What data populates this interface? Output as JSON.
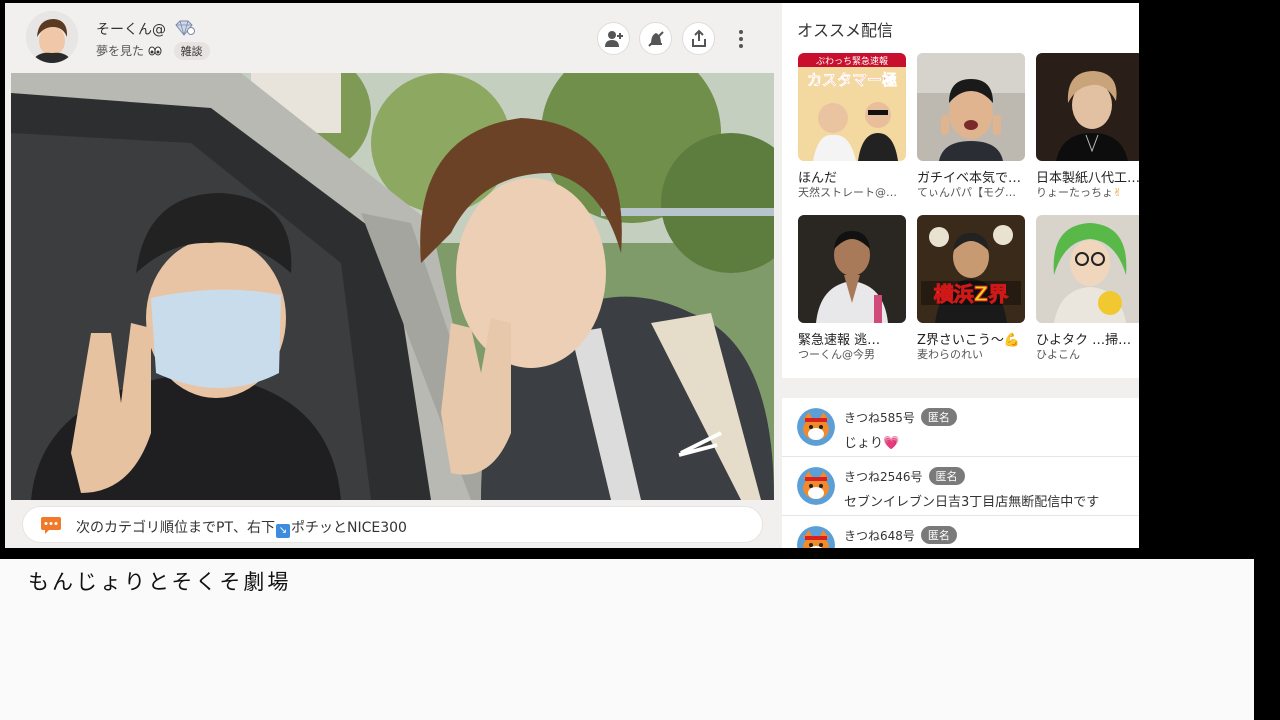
{
  "stream": {
    "streamer_name": "そーくん@",
    "title": "夢を見た",
    "category": "雑談",
    "ticker_prefix": "次のカテゴリ順位までPT、右下",
    "ticker_suffix": "ポチッとNICE300"
  },
  "header_buttons": {
    "follow": "follow-icon",
    "mute": "mute-icon",
    "share": "share-icon",
    "more": "more-icon"
  },
  "recommendations": {
    "title": "オススメ配信",
    "items": [
      {
        "name": "ほんだ",
        "user": "天然ストレート@…"
      },
      {
        "name": "ガチイベ本気で…",
        "user": "てぃんパパ【モグ…"
      },
      {
        "name": "日本製紙八代工…",
        "user": "りょーたっちょ"
      },
      {
        "name": "緊急速報 逃…",
        "user": "つーくん@今男"
      },
      {
        "name": "Z界さいこう～",
        "user": "麦わらのれい"
      },
      {
        "name": "ひよタク …掃…",
        "user": "ひよこん"
      }
    ],
    "thumb_texts": {
      "thumb1_banner": "ぷわっち緊急速報",
      "thumb1_main": "カスタマー極",
      "thumb5": "横浜Z界"
    }
  },
  "comments": [
    {
      "name": "きつね585号",
      "badge": "匿名",
      "text": "じょり"
    },
    {
      "name": "きつね2546号",
      "badge": "匿名",
      "text": "セブンイレブン日吉3丁目店無断配信中です"
    },
    {
      "name": "きつね648号",
      "badge": "匿名",
      "text": ""
    }
  ],
  "bottom": {
    "title": "もんじょりとそくそ劇場"
  },
  "colors": {
    "panel_bg": "#f2f0ee",
    "badge_gray": "#7a7a7a",
    "ticker_icon": "#f07a2a",
    "heart": "#e0358a"
  }
}
